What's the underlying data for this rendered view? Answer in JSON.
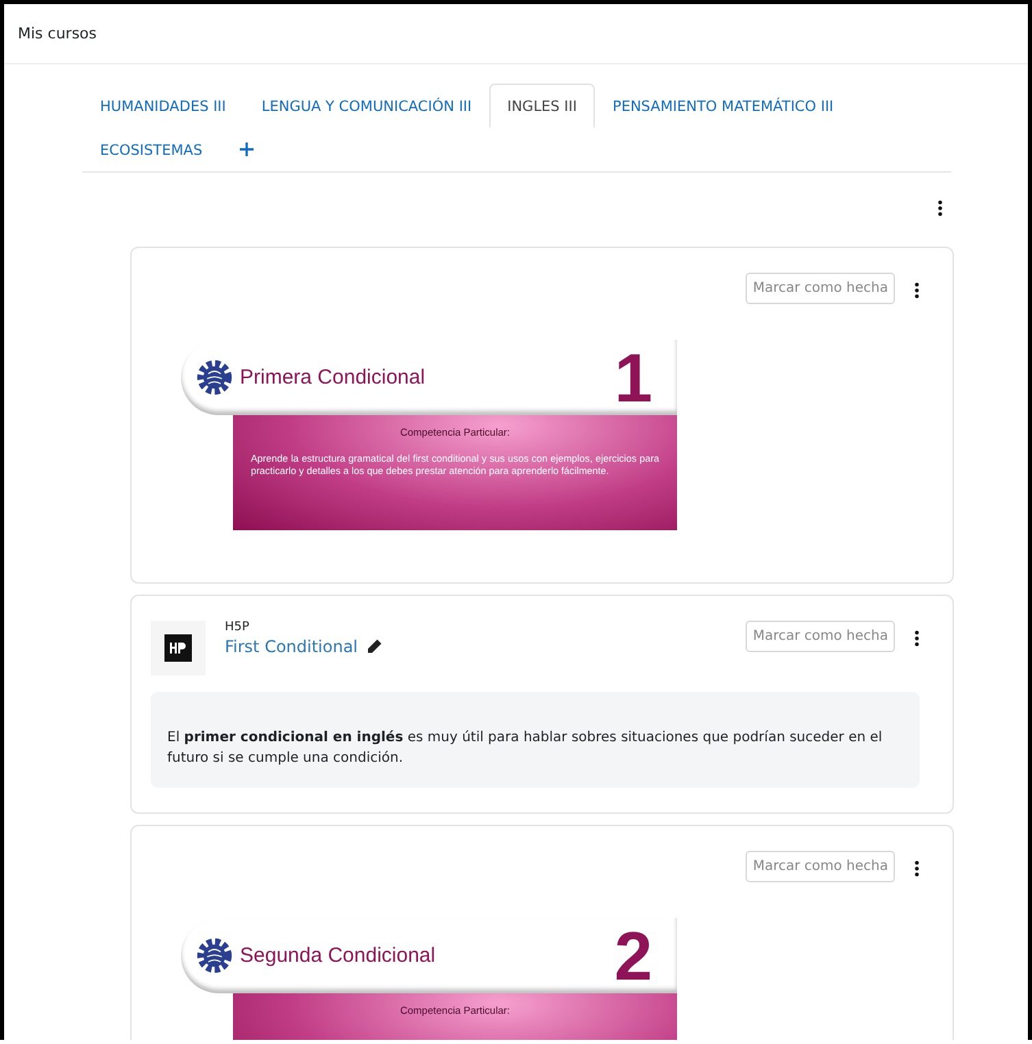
{
  "header": {
    "title": "Mis cursos"
  },
  "tabs": [
    {
      "label": "HUMANIDADES III",
      "selected": false
    },
    {
      "label": "LENGUA Y COMUNICACIÓN III",
      "selected": false
    },
    {
      "label": "INGLES III",
      "selected": true
    },
    {
      "label": "PENSAMIENTO MATEMÁTICO III",
      "selected": false
    },
    {
      "label": "ECOSISTEMAS",
      "selected": false
    }
  ],
  "activities": [
    {
      "kind": "banner",
      "button": "Marcar como hecha",
      "banner": {
        "title": "Primera Condicional",
        "number": "1",
        "subtitle": "Competencia Particular:",
        "text": "Aprende la estructura gramatical del first conditional y sus usos con ejemplos, ejercicios para practicarlo y detalles a los que debes prestar atención para aprenderlo fácilmente."
      }
    },
    {
      "kind": "h5p",
      "button": "Marcar como hecha",
      "type_label": "H5P",
      "link": "First Conditional",
      "description": "El **primer condicional en inglés** es muy útil para hablar sobres situaciones que podrían suceder en el futuro si se cumple una condición."
    },
    {
      "kind": "banner",
      "button": "Marcar como hecha",
      "banner": {
        "title": "Segunda Condicional",
        "number": "2",
        "subtitle": "Competencia Particular:"
      }
    }
  ]
}
